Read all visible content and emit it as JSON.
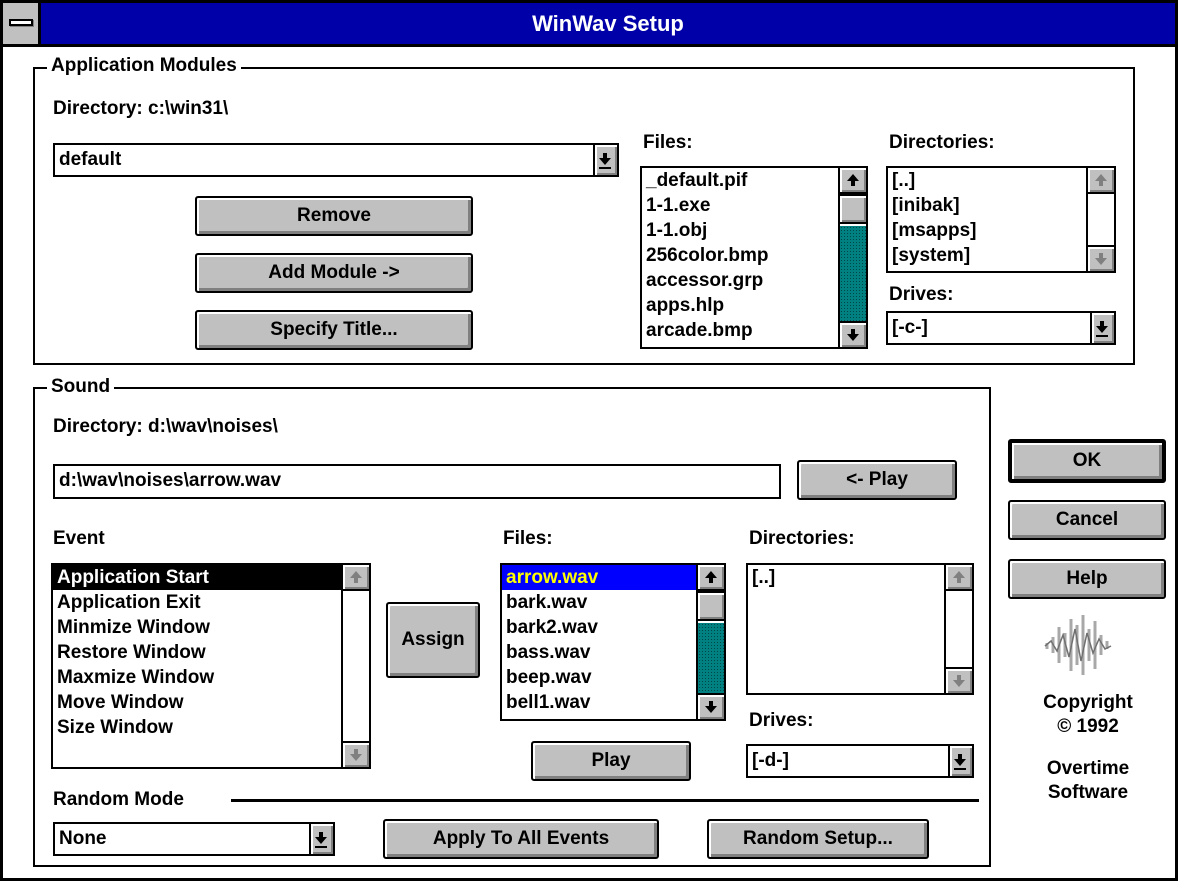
{
  "window": {
    "title": "WinWav Setup"
  },
  "app_modules": {
    "group_label": "Application Modules",
    "directory_label": "Directory: c:\\win31\\",
    "module_combo_value": "default",
    "remove_label": "Remove",
    "add_module_label": "Add Module ->",
    "specify_title_label": "Specify Title...",
    "files_label": "Files:",
    "files": [
      "_default.pif",
      "1-1.exe",
      "1-1.obj",
      "256color.bmp",
      "accessor.grp",
      "apps.hlp",
      "arcade.bmp"
    ],
    "directories_label": "Directories:",
    "directories": [
      "[..]",
      "[inibak]",
      "[msapps]",
      "[system]"
    ],
    "drives_label": "Drives:",
    "drive_value": "[-c-]"
  },
  "sound": {
    "group_label": "Sound",
    "directory_label": "Directory: d:\\wav\\noises\\",
    "path_value": "d:\\wav\\noises\\arrow.wav",
    "play_arrow_label": "<- Play",
    "event_label": "Event",
    "events": [
      "Application Start",
      "Application Exit",
      "Minmize Window",
      "Restore Window",
      "Maxmize Window",
      "Move Window",
      "Size Window"
    ],
    "assign_label": "Assign",
    "files_label": "Files:",
    "files": [
      "arrow.wav",
      "bark.wav",
      "bark2.wav",
      "bass.wav",
      "beep.wav",
      "bell1.wav"
    ],
    "play_label": "Play",
    "directories_label": "Directories:",
    "directories": [
      "[..]"
    ],
    "drives_label": "Drives:",
    "drive_value": "[-d-]",
    "random_mode_label": "Random Mode",
    "random_mode_value": "None",
    "apply_all_label": "Apply To All Events",
    "random_setup_label": "Random Setup..."
  },
  "buttons": {
    "ok": "OK",
    "cancel": "Cancel",
    "help": "Help"
  },
  "copyright": {
    "line1": "Copyright",
    "line2": "© 1992",
    "line3": "Overtime",
    "line4": "Software"
  }
}
